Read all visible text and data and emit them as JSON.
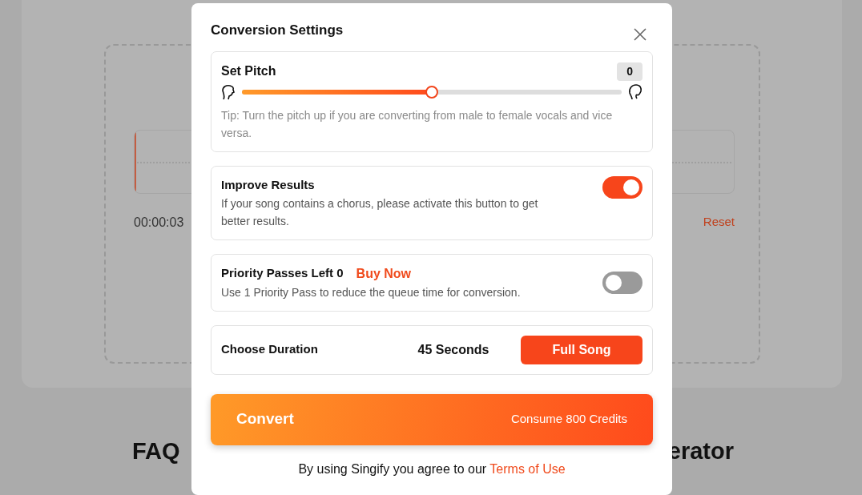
{
  "background": {
    "time": "00:00:03",
    "reset": "Reset",
    "faq_left": "FAQ",
    "faq_right": "erator"
  },
  "modal": {
    "title": "Conversion Settings",
    "pitch": {
      "label": "Set Pitch",
      "value": "0",
      "level": 0.5,
      "tip": "Tip: Turn the pitch up if you are converting from male to female vocals and vice versa."
    },
    "improve": {
      "label": "Improve Results",
      "description": "If your song contains a chorus, please activate this button to get better results.",
      "on": true
    },
    "priority": {
      "label": "Priority Passes Left 0",
      "link": "Buy Now",
      "description": "Use 1 Priority Pass to reduce the queue time for conversion.",
      "on": false
    },
    "duration": {
      "label": "Choose Duration",
      "options": [
        {
          "label": "45 Seconds",
          "selected": false
        },
        {
          "label": "Full Song",
          "selected": true
        }
      ]
    },
    "convert": {
      "label": "Convert",
      "cost": "Consume 800 Credits"
    },
    "terms": {
      "text": "By using Singify you agree to our",
      "link": "Terms of Use"
    }
  }
}
